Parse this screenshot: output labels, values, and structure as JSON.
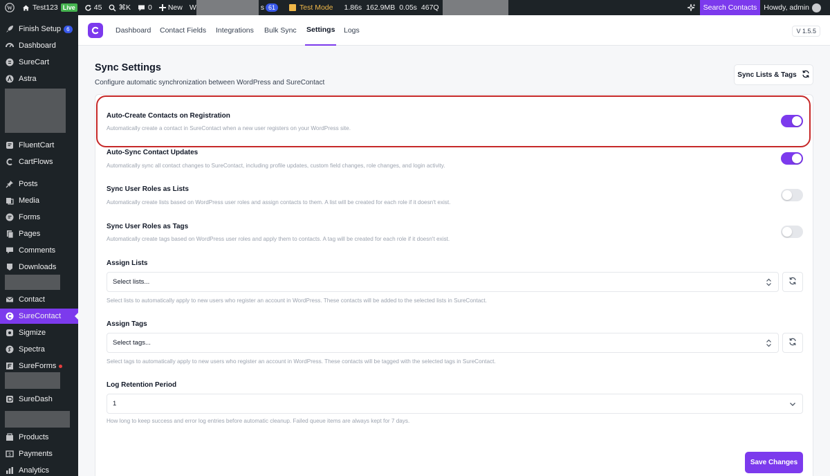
{
  "admin_bar": {
    "site_name": "Test123",
    "live_badge": "Live",
    "updates_count": "45",
    "shortcut": "⌘K",
    "comments_count": "0",
    "new_label": "New",
    "partial_w": "W",
    "partial_s": "s",
    "notif_count": "61",
    "test_mode": "Test Mode",
    "perf_time": "1.86s",
    "perf_mem": "162.9MB",
    "perf_q_time": "0.05s",
    "perf_queries": "467Q",
    "search_contacts": "Search Contacts",
    "howdy": "Howdy, admin"
  },
  "sidebar": {
    "finish_setup": "Finish Setup",
    "finish_setup_badge": "6",
    "dashboard": "Dashboard",
    "surecart": "SureCart",
    "astra": "Astra",
    "fluentcart": "FluentCart",
    "cartflows": "CartFlows",
    "posts": "Posts",
    "media": "Media",
    "forms": "Forms",
    "pages": "Pages",
    "comments": "Comments",
    "downloads": "Downloads",
    "contact": "Contact",
    "surecontact": "SureContact",
    "sigmize": "Sigmize",
    "spectra": "Spectra",
    "sureforms": "SureForms",
    "suredash": "SureDash",
    "products": "Products",
    "payments": "Payments",
    "analytics": "Analytics"
  },
  "nav": {
    "tabs": [
      "Dashboard",
      "Contact Fields",
      "Integrations",
      "Bulk Sync",
      "Settings",
      "Logs"
    ],
    "active_tab": "Settings",
    "version": "V 1.5.5"
  },
  "page": {
    "title": "Sync Settings",
    "subtitle": "Configure automatic synchronization between WordPress and SureContact",
    "sync_button": "Sync Lists & Tags",
    "save_button": "Save Changes"
  },
  "settings": {
    "auto_create": {
      "title": "Auto-Create Contacts on Registration",
      "desc": "Automatically create a contact in SureContact when a new user registers on your WordPress site.",
      "enabled": true
    },
    "auto_sync": {
      "title": "Auto-Sync Contact Updates",
      "desc": "Automatically sync all contact changes to SureContact, including profile updates, custom field changes, role changes, and login activity.",
      "enabled": true
    },
    "roles_lists": {
      "title": "Sync User Roles as Lists",
      "desc": "Automatically create lists based on WordPress user roles and assign contacts to them. A list will be created for each role if it doesn't exist.",
      "enabled": false
    },
    "roles_tags": {
      "title": "Sync User Roles as Tags",
      "desc": "Automatically create tags based on WordPress user roles and apply them to contacts. A tag will be created for each role if it doesn't exist.",
      "enabled": false
    },
    "assign_lists": {
      "label": "Assign Lists",
      "placeholder": "Select lists...",
      "help": "Select lists to automatically apply to new users who register an account in WordPress. These contacts will be added to the selected lists in SureContact."
    },
    "assign_tags": {
      "label": "Assign Tags",
      "placeholder": "Select tags...",
      "help": "Select tags to automatically apply to new users who register an account in WordPress. These contacts will be tagged with the selected tags in SureContact."
    },
    "log_retention": {
      "label": "Log Retention Period",
      "value": "1",
      "help": "How long to keep success and error log entries before automatic cleanup. Failed queue items are always kept for 7 days."
    }
  },
  "colors": {
    "accent": "#7c3aed",
    "admin_bar": "#1d2327",
    "highlight": "#c62828"
  }
}
